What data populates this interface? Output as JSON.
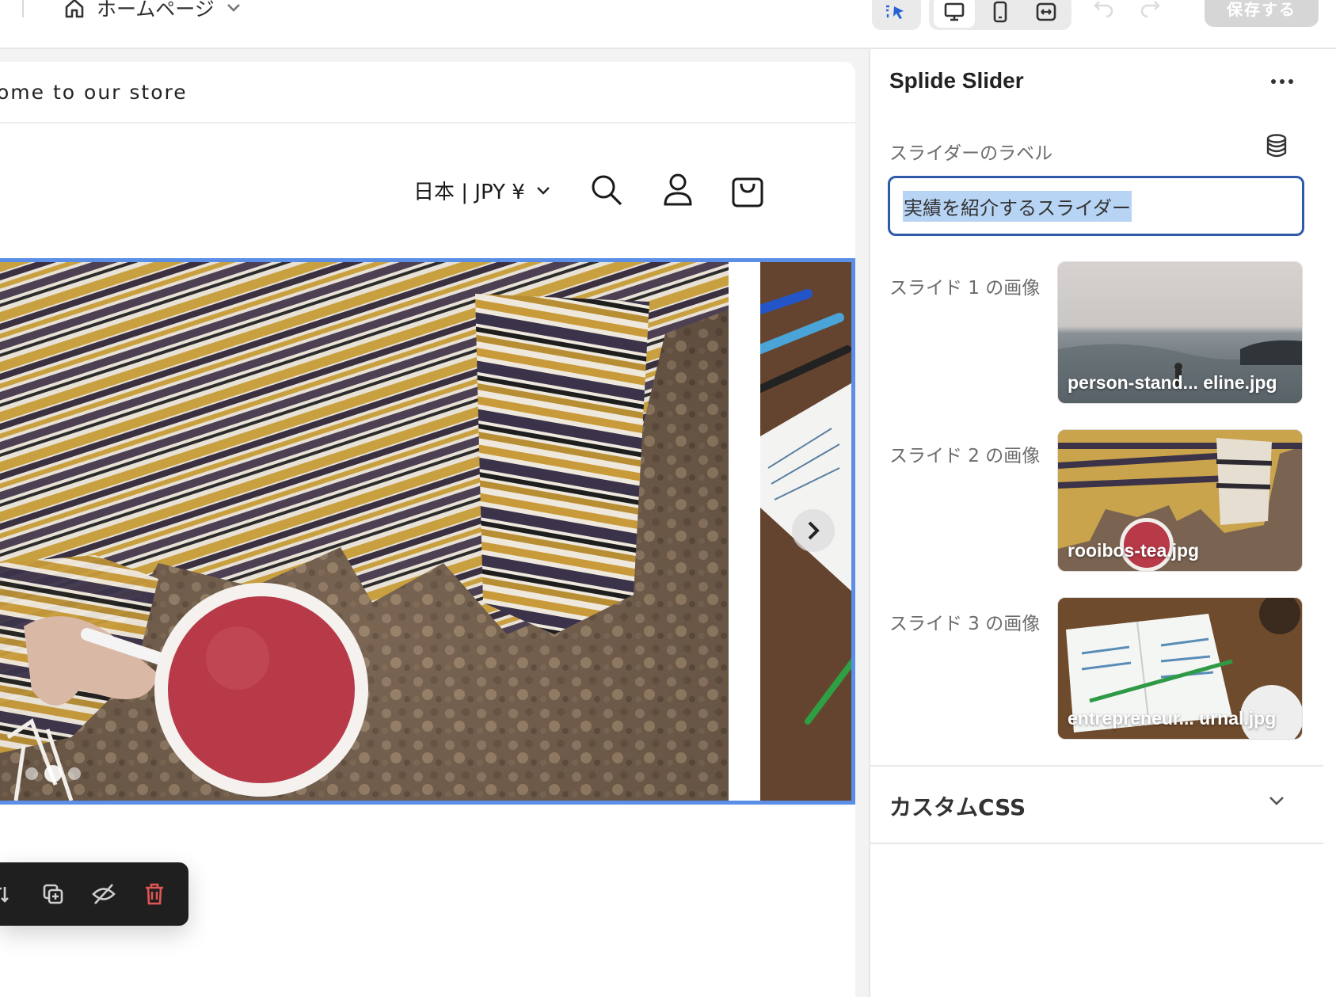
{
  "topbar": {
    "page_name": "ホームページ",
    "save_label": "保存する"
  },
  "store": {
    "announcement": "ome to our store",
    "locale": "日本 | JPY ¥",
    "slider": {
      "slide_count": 3,
      "active_slide": 2
    }
  },
  "panel": {
    "title": "Splide Slider",
    "label_field": {
      "label": "スライダーのラベル",
      "value": "実績を紹介するスライダー"
    },
    "slides": [
      {
        "label": "スライド 1 の画像",
        "filename": "person-stand... eline.jpg"
      },
      {
        "label": "スライド 2 の画像",
        "filename": "rooibos-tea.jpg"
      },
      {
        "label": "スライド 3 の画像",
        "filename": "entrepreneur... urnal.jpg"
      }
    ],
    "custom_css_label": "カスタムCSS"
  },
  "icons": {
    "home": "home-icon",
    "chevron": "chevron-down-icon",
    "select": "select-pointer-icon",
    "desktop": "desktop-icon",
    "mobile": "mobile-icon",
    "fullwidth": "fullwidth-icon",
    "undo": "undo-icon",
    "redo": "redo-icon",
    "search": "search-icon",
    "account": "account-icon",
    "cart": "cart-icon",
    "database": "database-icon",
    "more": "more-icon"
  },
  "colors": {
    "selection_outline": "#5b8ee6",
    "input_focus": "#2e5aa8",
    "text_selection": "#b8d4f5",
    "toolbar_bg": "#1f1f1f",
    "delete": "#e05555"
  }
}
